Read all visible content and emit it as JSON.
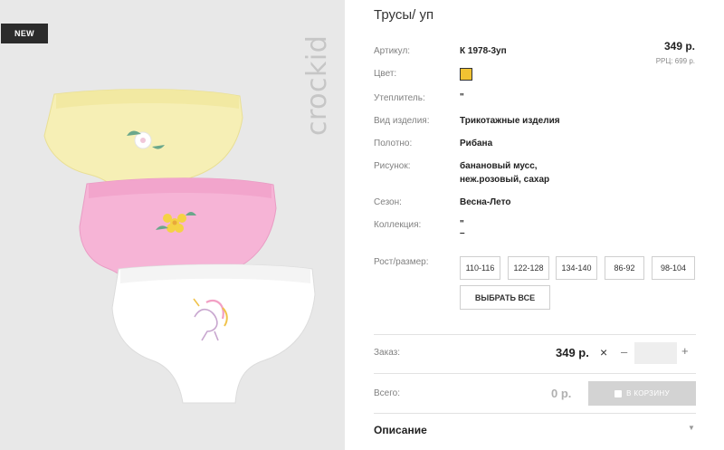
{
  "image": {
    "badge": "NEW",
    "brand_watermark": "crockid",
    "panties": [
      {
        "color": "#f7f1b3",
        "print": "flower-icon"
      },
      {
        "color": "#f5b9d8",
        "print": "flower-icon"
      },
      {
        "color": "#ffffff",
        "print": "unicorn-icon"
      }
    ]
  },
  "product": {
    "title": "Трусы/ уп",
    "price": "349 р.",
    "rrp": "РРЦ: 699 р.",
    "swatch_color": "#f1c232",
    "attributes": {
      "article_label": "Артикул:",
      "article_value": "К 1978-3уп",
      "color_label": "Цвет:",
      "insulation_label": "Утеплитель:",
      "insulation_value": "\"",
      "type_label": "Вид изделия:",
      "type_value": "Трикотажные изделия",
      "fabric_label": "Полотно:",
      "fabric_value": "Рибана",
      "pattern_label": "Рисунок:",
      "pattern_line1": "банановый мусс,",
      "pattern_line2": "неж.розовый, сахар",
      "season_label": "Сезон:",
      "season_value": "Весна-Лето",
      "collection_label": "Коллекция:",
      "collection_line1": "\"",
      "collection_line2": "–"
    },
    "sizes_label": "Рост/размер:",
    "sizes": [
      "110-116",
      "122-128",
      "134-140",
      "86-92",
      "98-104"
    ],
    "select_all": "ВЫБРАТЬ ВСЕ"
  },
  "order": {
    "label": "Заказ:",
    "price": "349 р.",
    "times": "×",
    "minus": "–",
    "plus": "+",
    "qty_value": ""
  },
  "total": {
    "label": "Всего:",
    "value": "0 р.",
    "cart_button": "В КОРЗИНУ"
  },
  "description": {
    "label": "Описание"
  }
}
